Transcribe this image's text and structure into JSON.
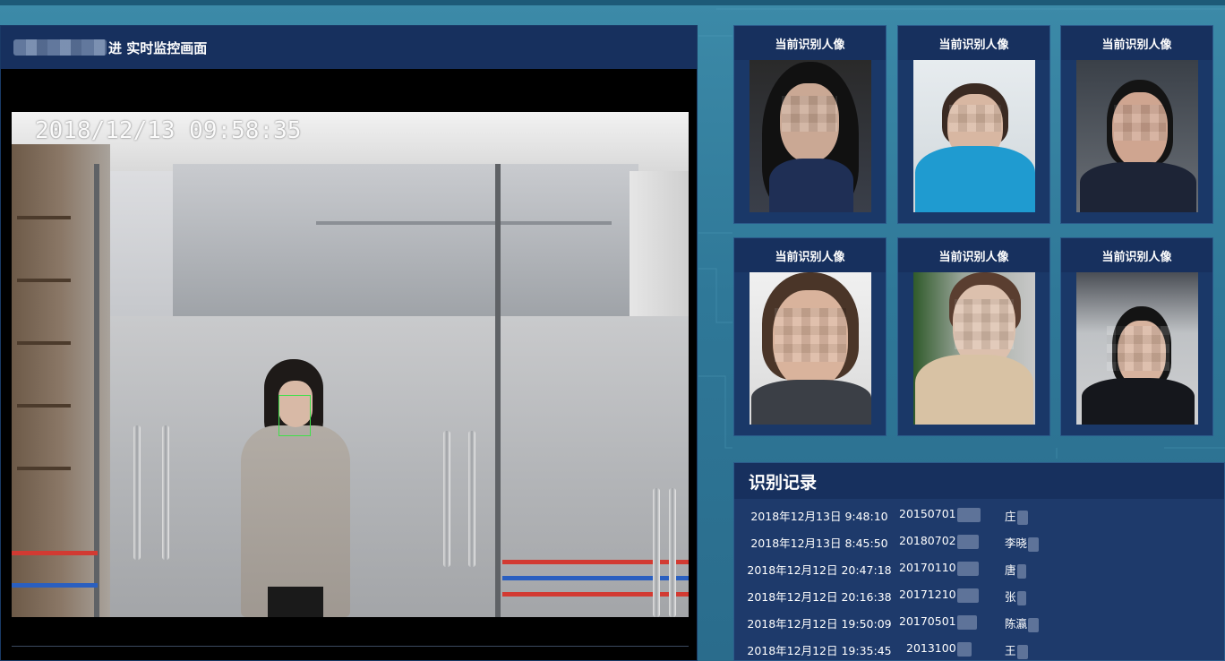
{
  "monitor": {
    "title": "进 实时监控画面",
    "timestamp": "2018/12/13 09:58:35"
  },
  "face_cards": [
    {
      "header": "当前识别人像",
      "photo": "face-photo-1"
    },
    {
      "header": "当前识别人像",
      "photo": "face-photo-2"
    },
    {
      "header": "当前识别人像",
      "photo": "face-photo-3"
    },
    {
      "header": "当前识别人像",
      "photo": "face-photo-4"
    },
    {
      "header": "当前识别人像",
      "photo": "face-photo-5"
    },
    {
      "header": "当前识别人像",
      "photo": "face-photo-6"
    }
  ],
  "records": {
    "title": "识别记录",
    "rows": [
      {
        "time": "2018年12月13日 9:48:10",
        "id": "20150701",
        "name": "庄"
      },
      {
        "time": "2018年12月13日 8:45:50",
        "id": "20180702",
        "name": "李晓"
      },
      {
        "time": "2018年12月12日 20:47:18",
        "id": "20170110",
        "name": "唐"
      },
      {
        "time": "2018年12月12日 20:16:38",
        "id": "20171210",
        "name": "张"
      },
      {
        "time": "2018年12月12日 19:50:09",
        "id": "20170501",
        "name": "陈瀛"
      },
      {
        "time": "2018年12月12日 19:35:45",
        "id": "2013100",
        "name": "王"
      }
    ]
  },
  "colors": {
    "panel_header": "#17305e",
    "panel_body": "#1e3a6b",
    "background": "#2f7898",
    "face_box": "#3fe04a"
  }
}
